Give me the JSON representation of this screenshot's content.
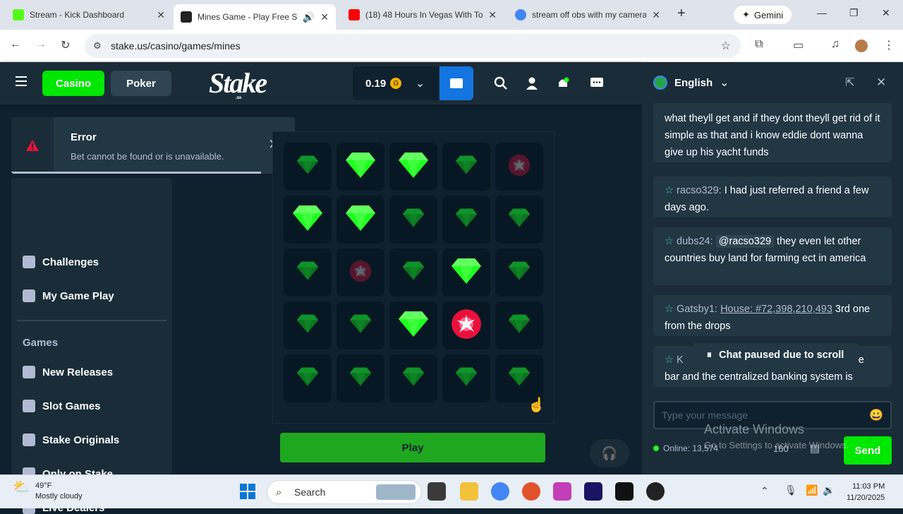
{
  "browser": {
    "tabs": [
      {
        "title": "Stream - Kick Dashboard",
        "active": false
      },
      {
        "title": "Mines Game - Play Free So",
        "active": true
      },
      {
        "title": "(18) 48 Hours In Vegas With To",
        "active": false
      },
      {
        "title": "stream off obs with my camera",
        "active": false
      }
    ],
    "gemini_label": "Gemini",
    "url": "stake.us/casino/games/mines"
  },
  "header": {
    "casino_label": "Casino",
    "poker_label": "Poker",
    "logo_text": "Stake",
    "logo_sub": ".us",
    "balance": "0.19",
    "coin_symbol": "G"
  },
  "toast": {
    "title": "Error",
    "message": "Bet cannot be found or is unavailable."
  },
  "sidebar": {
    "items_top": [
      {
        "label": "Challenges"
      },
      {
        "label": "My Game Play"
      }
    ],
    "games_heading": "Games",
    "items_games": [
      {
        "label": "New Releases"
      },
      {
        "label": "Slot Games"
      },
      {
        "label": "Stake Originals"
      },
      {
        "label": "Only on Stake"
      },
      {
        "label": "Live Dealers"
      }
    ]
  },
  "game": {
    "grid": [
      [
        "gem-dim",
        "gem",
        "gem",
        "gem-dim",
        "mine-dim"
      ],
      [
        "gem",
        "gem",
        "gem-dim",
        "gem-dim",
        "gem-dim"
      ],
      [
        "gem-dim",
        "mine-dim",
        "gem-dim",
        "gem",
        "gem-dim"
      ],
      [
        "gem-dim",
        "gem-dim",
        "gem",
        "mine",
        "gem-dim"
      ],
      [
        "gem-dim",
        "gem-dim",
        "gem-dim",
        "gem-dim",
        "gem-dim"
      ]
    ],
    "play_label": "Play"
  },
  "chat": {
    "language": "English",
    "messages": [
      {
        "user": "",
        "text": "what theyll get and if they dont theyll get rid of it simple as that and i know eddie dont wanna give up his yacht funds"
      },
      {
        "user": "racso329",
        "text": "I had just referred a friend a few days ago."
      },
      {
        "user": "dubs24",
        "mention": "@racso329",
        "text": "they even let other countries buy land for farming ect in america"
      },
      {
        "user": "Gatsby1",
        "link": "House: #72,398,210,493",
        "text": "3rd one from the drops"
      },
      {
        "user": "K",
        "text": "the bar and the centralized banking system is"
      }
    ],
    "paused_label": "Chat paused due to scroll",
    "input_placeholder": "Type your message",
    "online_text": "Online: 13,574",
    "char_count": "160",
    "send_label": "Send"
  },
  "watermark": {
    "line1": "Activate Windows",
    "line2": "Go to Settings to activate Windows."
  },
  "taskbar": {
    "temp": "49°F",
    "weather": "Mostly cloudy",
    "search_label": "Search",
    "time": "11:03 PM",
    "date": "11/20/2025"
  },
  "colors": {
    "accent_green": "#00e701",
    "bg": "#0f212e",
    "panel": "#1a2c38",
    "blue": "#1475e1",
    "mine_red": "#e9113c"
  }
}
